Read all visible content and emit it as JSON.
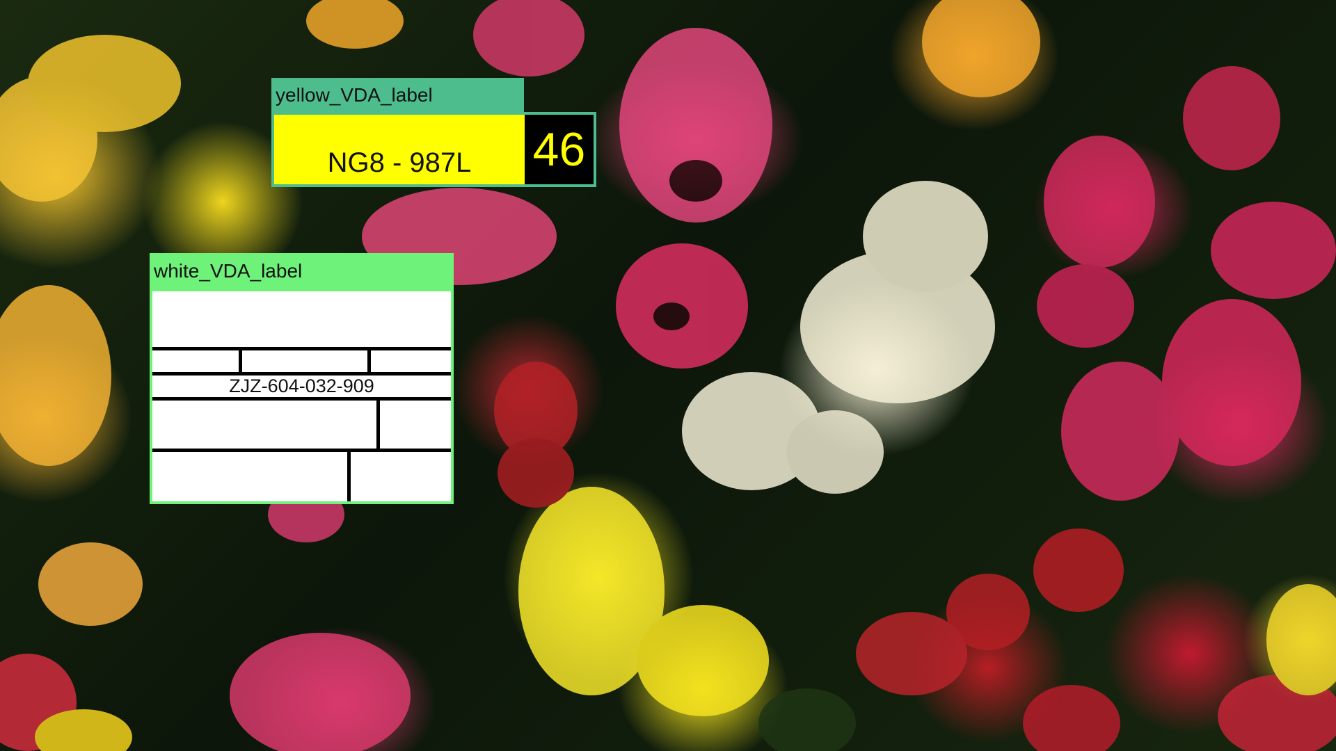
{
  "scene": {
    "description_colors": {
      "yellow_label_tag": "#4ebd8e",
      "white_label_tag": "#6ef27a",
      "plate_background": "#ffff00",
      "number_background": "#000000",
      "number_color": "#ffff00"
    }
  },
  "yellow_label": {
    "tag": "yellow_VDA_label",
    "plate_text": "NG8 - 987L",
    "number": "46"
  },
  "white_label": {
    "tag": "white_VDA_label",
    "serial": "ZJZ-604-032-909"
  }
}
